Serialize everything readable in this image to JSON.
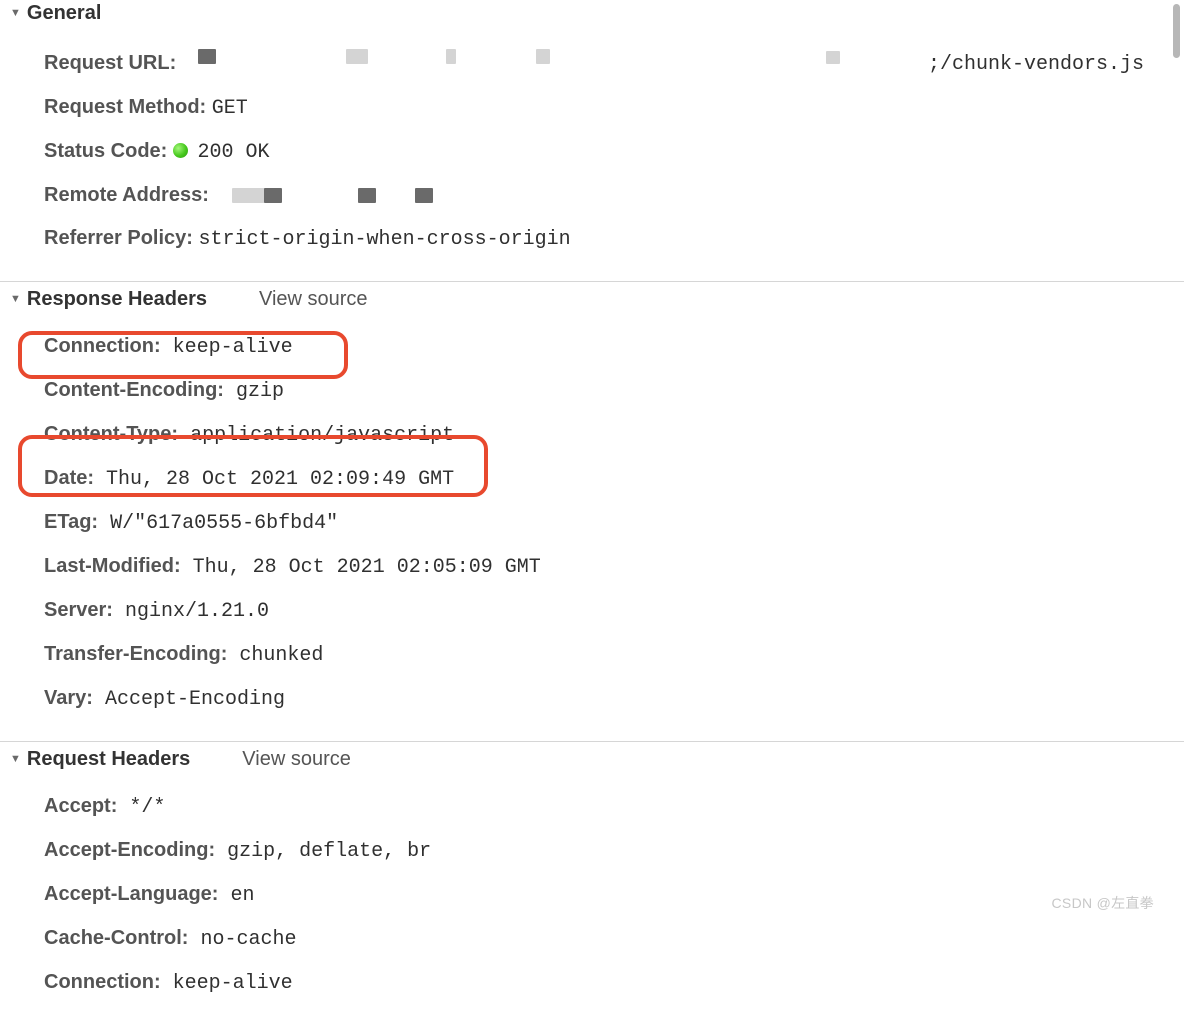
{
  "sections": {
    "general": {
      "title": "General",
      "request_url_label": "Request URL:",
      "request_url_tail": ";/chunk-vendors.js",
      "request_method_label": "Request Method:",
      "request_method_value": "GET",
      "status_code_label": "Status Code:",
      "status_code_value": "200 OK",
      "remote_address_label": "Remote Address:",
      "referrer_policy_label": "Referrer Policy:",
      "referrer_policy_value": "strict-origin-when-cross-origin"
    },
    "response": {
      "title": "Response Headers",
      "view_source": "View source",
      "headers": [
        {
          "label": "Connection:",
          "value": "keep-alive"
        },
        {
          "label": "Content-Encoding:",
          "value": "gzip"
        },
        {
          "label": "Content-Type:",
          "value": "application/javascript"
        },
        {
          "label": "Date:",
          "value": "Thu, 28 Oct 2021 02:09:49 GMT"
        },
        {
          "label": "ETag:",
          "value": "W/\"617a0555-6bfbd4\""
        },
        {
          "label": "Last-Modified:",
          "value": "Thu, 28 Oct 2021 02:05:09 GMT"
        },
        {
          "label": "Server:",
          "value": "nginx/1.21.0"
        },
        {
          "label": "Transfer-Encoding:",
          "value": "chunked"
        },
        {
          "label": "Vary:",
          "value": "Accept-Encoding"
        }
      ]
    },
    "request": {
      "title": "Request Headers",
      "view_source": "View source",
      "headers": [
        {
          "label": "Accept:",
          "value": "*/*"
        },
        {
          "label": "Accept-Encoding:",
          "value": "gzip, deflate, br"
        },
        {
          "label": "Accept-Language:",
          "value": "en"
        },
        {
          "label": "Cache-Control:",
          "value": "no-cache"
        },
        {
          "label": "Connection:",
          "value": "keep-alive"
        }
      ]
    }
  },
  "watermark": "CSDN @左直拳"
}
